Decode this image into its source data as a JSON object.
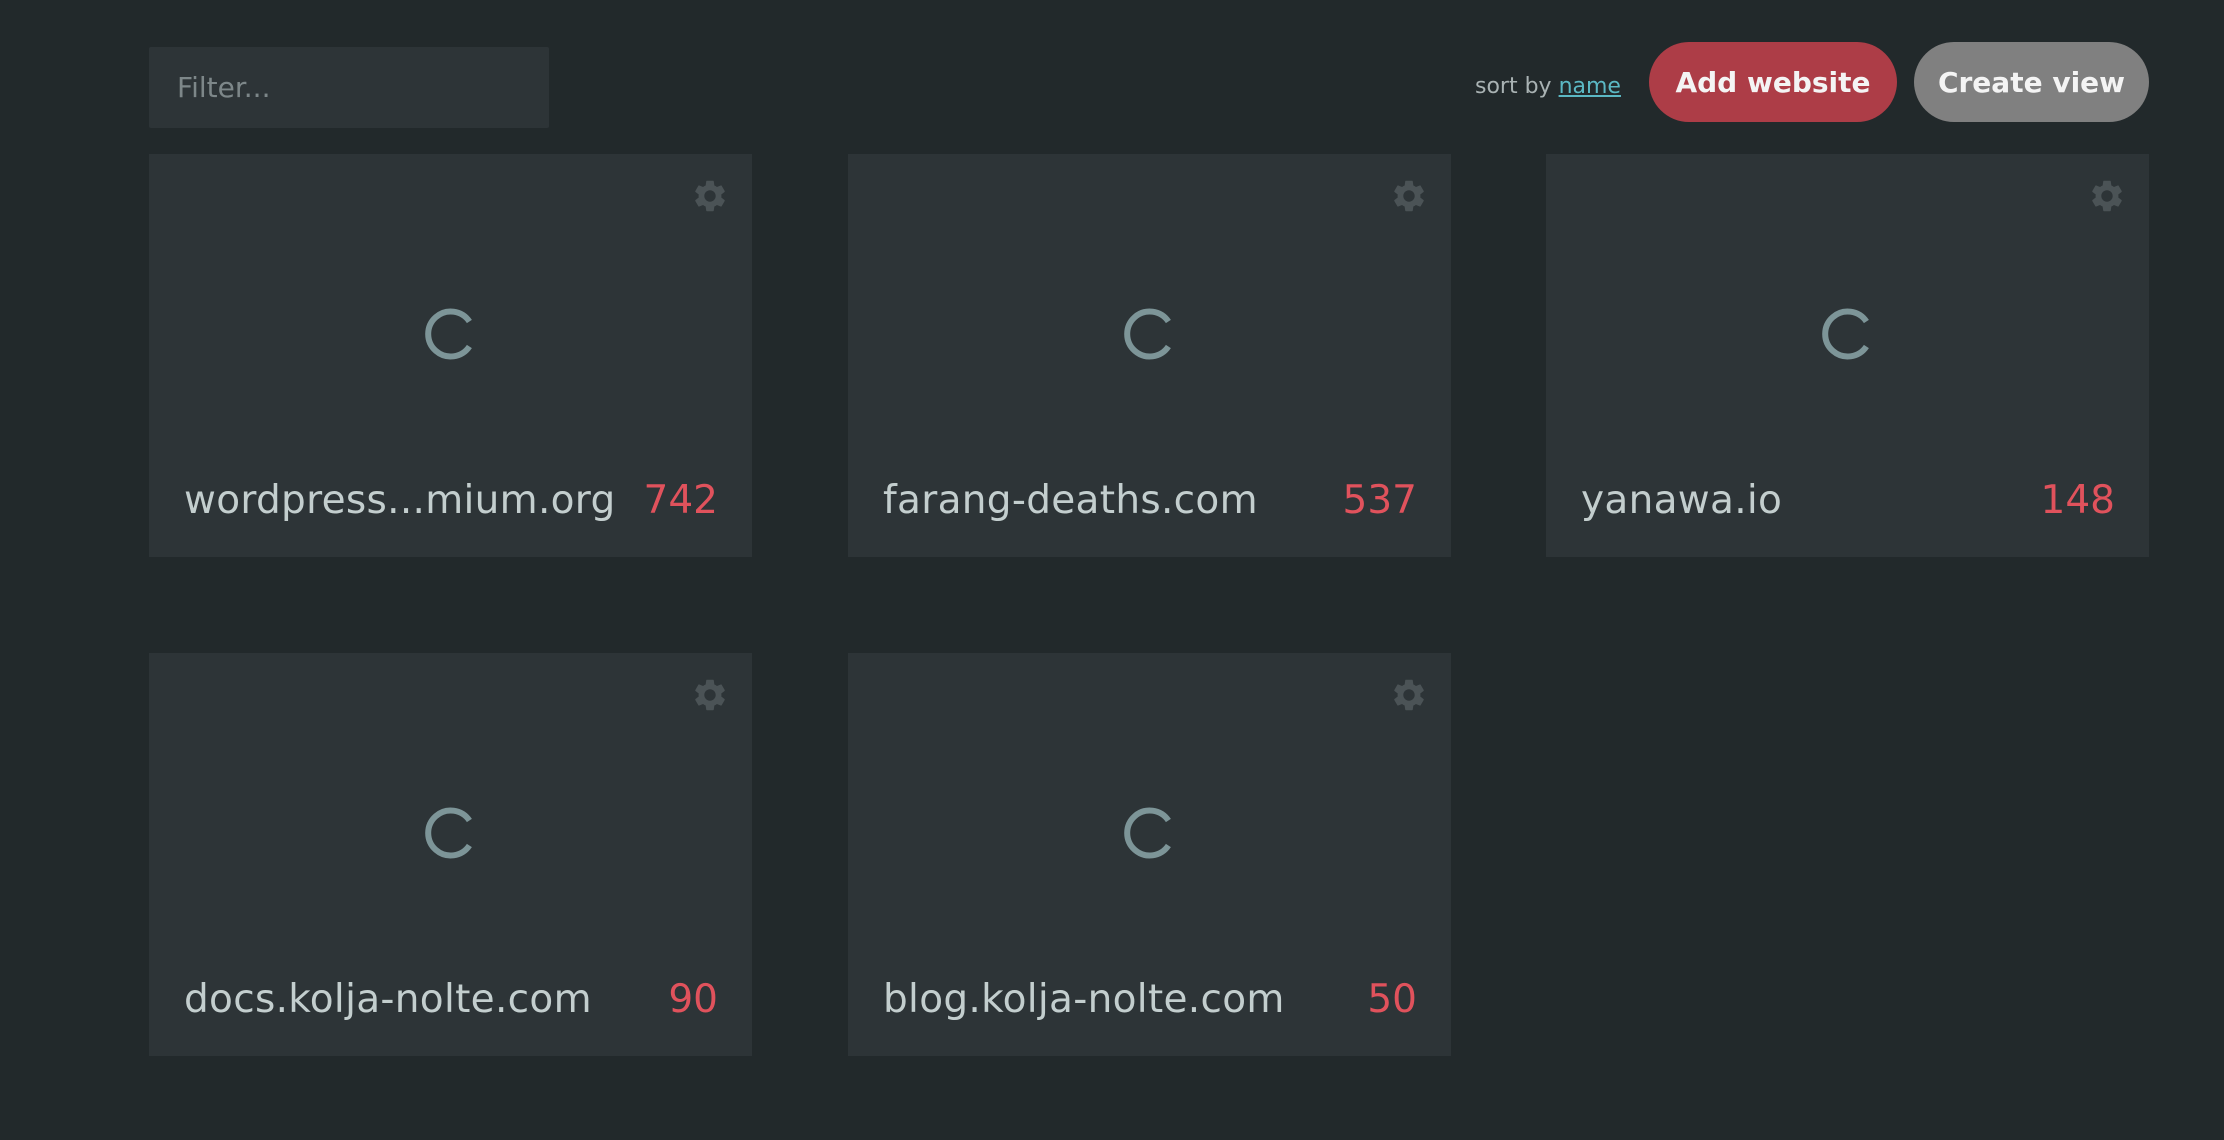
{
  "toolbar": {
    "filter_placeholder": "Filter...",
    "sort_prefix": "sort by",
    "sort_field": "name",
    "add_website_label": "Add website",
    "create_view_label": "Create view"
  },
  "colors": {
    "background": "#22292b",
    "card": "#2d3437",
    "accent_red": "#ad3d47",
    "count_red": "#e0525c",
    "link_cyan": "#5bb8c4",
    "gray_button": "#808080"
  },
  "sites": [
    {
      "name": "wordpress...mium.org",
      "count": "742",
      "icon": "gear-icon",
      "loader": "loading-spinner-icon"
    },
    {
      "name": "farang-deaths.com",
      "count": "537",
      "icon": "gear-icon",
      "loader": "loading-spinner-icon"
    },
    {
      "name": "yanawa.io",
      "count": "148",
      "icon": "gear-icon",
      "loader": "loading-spinner-icon"
    },
    {
      "name": "docs.kolja-nolte.com",
      "count": "90",
      "icon": "gear-icon",
      "loader": "loading-spinner-icon"
    },
    {
      "name": "blog.kolja-nolte.com",
      "count": "50",
      "icon": "gear-icon",
      "loader": "loading-spinner-icon"
    }
  ]
}
